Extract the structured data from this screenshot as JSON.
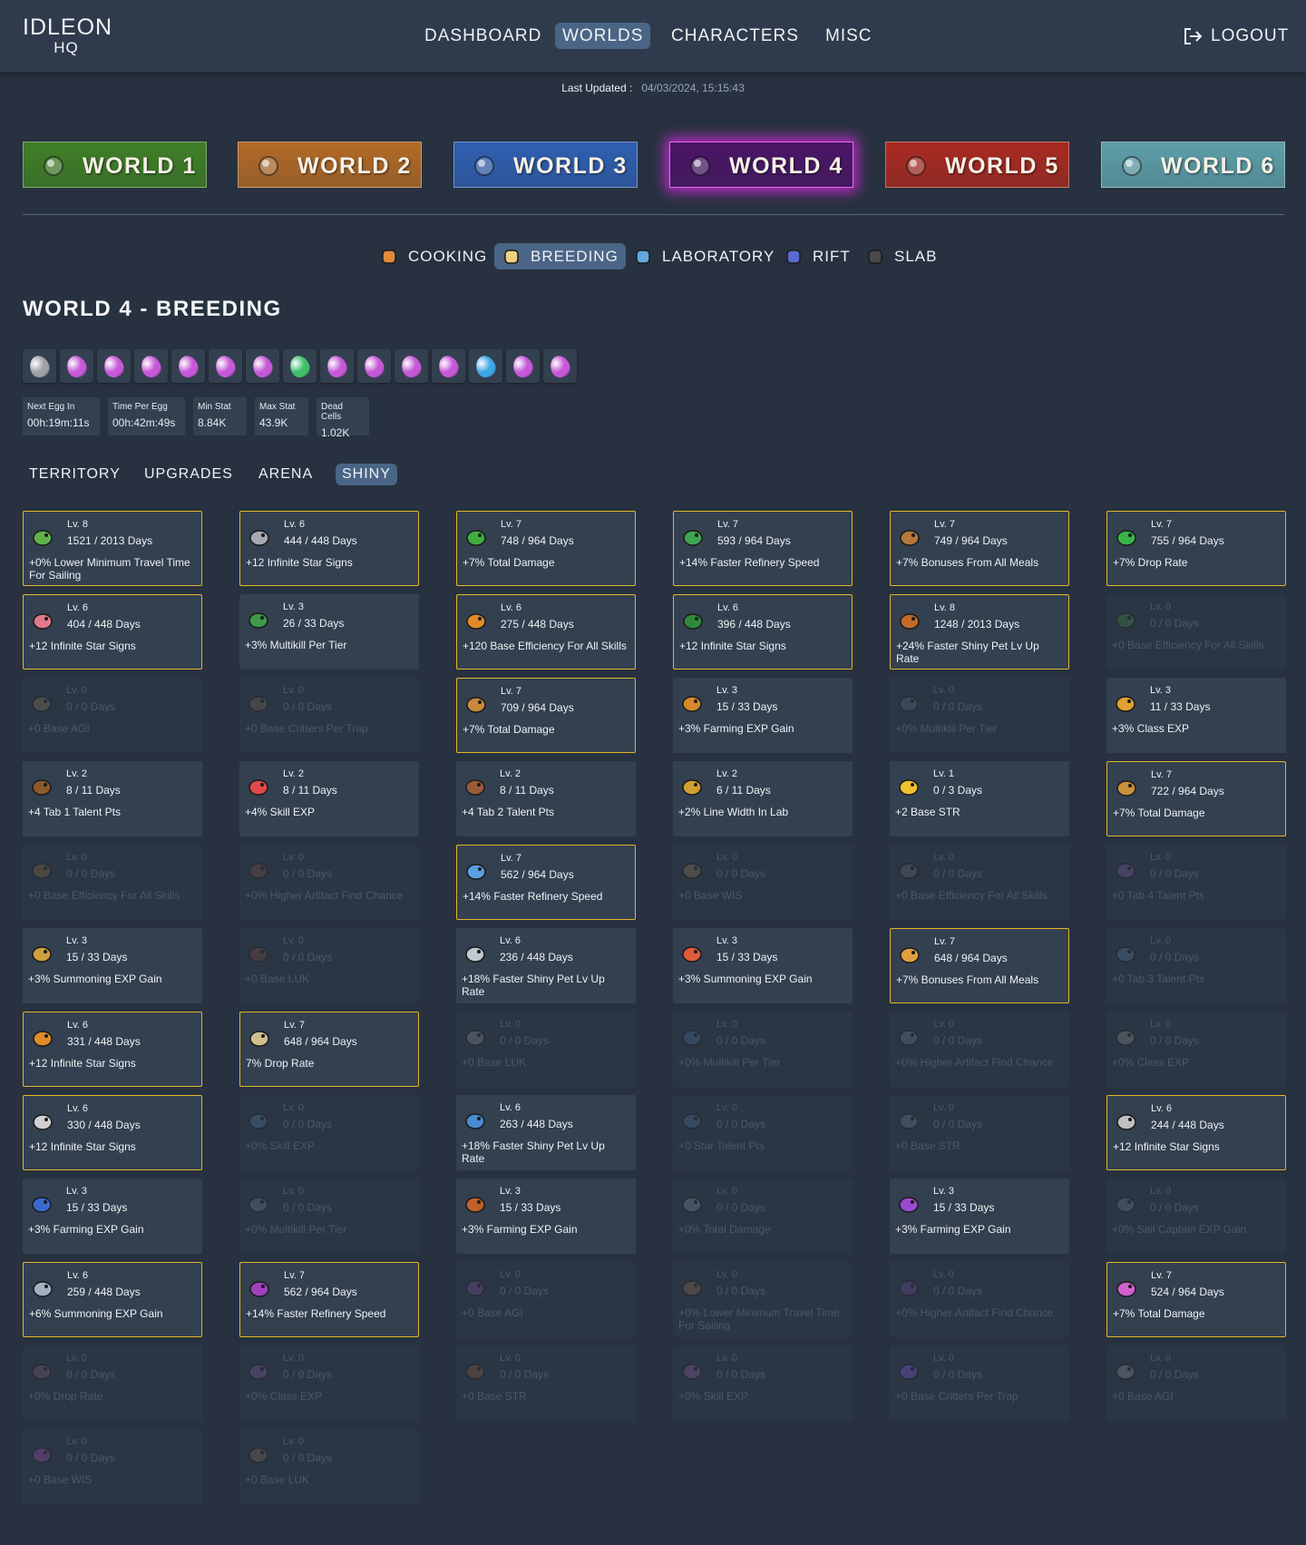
{
  "logo": {
    "line1": "IDLEON",
    "line2": "HQ"
  },
  "nav": {
    "dashboard": "DASHBOARD",
    "worlds": "WORLDS",
    "characters": "CHARACTERS",
    "misc": "MISC",
    "logout": "LOGOUT"
  },
  "last_updated": {
    "label": "Last Updated :",
    "value": "04/03/2024, 15:15:43"
  },
  "worlds": [
    {
      "label": "WORLD 1",
      "bg": "#3f7f26",
      "icon": "world-1-icon"
    },
    {
      "label": "WORLD 2",
      "bg": "#b26a26",
      "icon": "world-2-icon"
    },
    {
      "label": "WORLD 3",
      "bg": "#2f5fb0",
      "icon": "world-3-icon"
    },
    {
      "label": "WORLD 4",
      "bg": "#4a1566",
      "icon": "world-4-icon"
    },
    {
      "label": "WORLD 5",
      "bg": "#a92a20",
      "icon": "world-5-icon"
    },
    {
      "label": "WORLD 6",
      "bg": "#5d9fa9",
      "icon": "world-6-icon"
    }
  ],
  "subtabs": [
    {
      "label": "COOKING",
      "icon": "cooking-icon"
    },
    {
      "label": "BREEDING",
      "icon": "breeding-icon"
    },
    {
      "label": "LABORATORY",
      "icon": "laboratory-icon"
    },
    {
      "label": "RIFT",
      "icon": "rift-icon"
    },
    {
      "label": "SLAB",
      "icon": "slab-icon"
    }
  ],
  "page_title": "WORLD 4 - BREEDING",
  "eggs": [
    "#9ea1a6",
    "#c658d8",
    "#c658d8",
    "#c658d8",
    "#c658d8",
    "#c658d8",
    "#c658d8",
    "#3ec06a",
    "#c658d8",
    "#c658d8",
    "#c658d8",
    "#c658d8",
    "#3ea6e6",
    "#c658d8",
    "#c658d8"
  ],
  "stats": [
    {
      "label": "Next Egg In",
      "value": "00h:19m:11s"
    },
    {
      "label": "Time Per Egg",
      "value": "00h:42m:49s"
    },
    {
      "label": "Min Stat",
      "value": "8.84K"
    },
    {
      "label": "Max Stat",
      "value": "43.9K"
    },
    {
      "label": "Dead Cells",
      "value": "1.02K"
    }
  ],
  "tabs": {
    "territory": "TERRITORY",
    "upgrades": "UPGRADES",
    "arena": "ARENA",
    "shiny": "SHINY"
  },
  "colors": {
    "accent": "#4a6585",
    "gold_border": "#e0b72a",
    "card_bg": "#33404f",
    "page_bg": "#27313f"
  },
  "pets": [
    {
      "lv": "Lv. 8",
      "days": "1521 / 2013 Days",
      "bonus": "+0% Lower Minimum Travel Time For Sailing",
      "gold": true,
      "dim": false,
      "color": "#5fb24a"
    },
    {
      "lv": "Lv. 6",
      "days": "444 / 448 Days",
      "bonus": "+12 Infinite Star Signs",
      "gold": true,
      "dim": false,
      "color": "#a4a8b0"
    },
    {
      "lv": "Lv. 7",
      "days": "748 / 964 Days",
      "bonus": "+7% Total Damage",
      "gold": true,
      "dim": false,
      "color": "#3fae3f"
    },
    {
      "lv": "Lv. 7",
      "days": "593 / 964 Days",
      "bonus": "+14% Faster Refinery Speed",
      "gold": true,
      "dim": false,
      "color": "#3da550"
    },
    {
      "lv": "Lv. 7",
      "days": "749 / 964 Days",
      "bonus": "+7% Bonuses From All Meals",
      "gold": true,
      "dim": false,
      "color": "#b5773a"
    },
    {
      "lv": "Lv. 7",
      "days": "755 / 964 Days",
      "bonus": "+7% Drop Rate",
      "gold": true,
      "dim": false,
      "color": "#36b44a"
    },
    {
      "lv": "Lv. 6",
      "days": "404 / 448 Days",
      "bonus": "+12 Infinite Star Signs",
      "gold": true,
      "dim": false,
      "color": "#e07a8a"
    },
    {
      "lv": "Lv. 3",
      "days": "26 / 33 Days",
      "bonus": "+3% Multikill Per Tier",
      "gold": false,
      "dim": false,
      "color": "#3c9a4a"
    },
    {
      "lv": "Lv. 6",
      "days": "275 / 448 Days",
      "bonus": "+120 Base Efficiency For All Skills",
      "gold": true,
      "dim": false,
      "color": "#e08a2a"
    },
    {
      "lv": "Lv. 6",
      "days": "396 / 448 Days",
      "bonus": "+12 Infinite Star Signs",
      "gold": true,
      "dim": false,
      "color": "#2f8a3a"
    },
    {
      "lv": "Lv. 8",
      "days": "1248 / 2013 Days",
      "bonus": "+24% Faster Shiny Pet Lv Up Rate",
      "gold": true,
      "dim": false,
      "color": "#c26a2a"
    },
    {
      "lv": "Lv. 0",
      "days": "0 / 0 Days",
      "bonus": "+0 Base Efficiency For All Skills",
      "gold": false,
      "dim": true,
      "color": "#3c8a3a"
    },
    {
      "lv": "Lv. 0",
      "days": "0 / 0 Days",
      "bonus": "+0 Base AGI",
      "gold": false,
      "dim": true,
      "color": "#8a7a5a"
    },
    {
      "lv": "Lv. 0",
      "days": "0 / 0 Days",
      "bonus": "+0 Base Critters Per Trap",
      "gold": false,
      "dim": true,
      "color": "#7a6a4a"
    },
    {
      "lv": "Lv. 7",
      "days": "709 / 964 Days",
      "bonus": "+7% Total Damage",
      "gold": true,
      "dim": false,
      "color": "#c88a3a"
    },
    {
      "lv": "Lv. 3",
      "days": "15 / 33 Days",
      "bonus": "+3% Farming EXP Gain",
      "gold": false,
      "dim": false,
      "color": "#d6892a"
    },
    {
      "lv": "Lv. 0",
      "days": "0 / 0 Days",
      "bonus": "+0% Multikill Per Tier",
      "gold": false,
      "dim": true,
      "color": "#5a6a7a"
    },
    {
      "lv": "Lv. 3",
      "days": "11 / 33 Days",
      "bonus": "+3% Class EXP",
      "gold": false,
      "dim": false,
      "color": "#e0a030"
    },
    {
      "lv": "Lv. 2",
      "days": "8 / 11 Days",
      "bonus": "+4 Tab 1 Talent Pts",
      "gold": false,
      "dim": false,
      "color": "#8a5a2a"
    },
    {
      "lv": "Lv. 2",
      "days": "8 / 11 Days",
      "bonus": "+4% Skill EXP",
      "gold": false,
      "dim": false,
      "color": "#e04a4a"
    },
    {
      "lv": "Lv. 2",
      "days": "8 / 11 Days",
      "bonus": "+4 Tab 2 Talent Pts",
      "gold": false,
      "dim": false,
      "color": "#9a5a3a"
    },
    {
      "lv": "Lv. 2",
      "days": "6 / 11 Days",
      "bonus": "+2% Line Width In Lab",
      "gold": false,
      "dim": false,
      "color": "#d0a030"
    },
    {
      "lv": "Lv. 1",
      "days": "0 / 3 Days",
      "bonus": "+2 Base STR",
      "gold": false,
      "dim": false,
      "color": "#f0c030"
    },
    {
      "lv": "Lv. 7",
      "days": "722 / 964 Days",
      "bonus": "+7% Total Damage",
      "gold": true,
      "dim": false,
      "color": "#c8903a"
    },
    {
      "lv": "Lv. 0",
      "days": "0 / 0 Days",
      "bonus": "+0 Base Efficiency For All Skills",
      "gold": false,
      "dim": true,
      "color": "#8a6a3a"
    },
    {
      "lv": "Lv. 0",
      "days": "0 / 0 Days",
      "bonus": "+0% Higher Artifact Find Chance",
      "gold": false,
      "dim": true,
      "color": "#7a4a3a"
    },
    {
      "lv": "Lv. 7",
      "days": "562 / 964 Days",
      "bonus": "+14% Faster Refinery Speed",
      "gold": true,
      "dim": false,
      "color": "#5aa0e0"
    },
    {
      "lv": "Lv. 0",
      "days": "0 / 0 Days",
      "bonus": "+0 Base WIS",
      "gold": false,
      "dim": true,
      "color": "#8a7a4a"
    },
    {
      "lv": "Lv. 0",
      "days": "0 / 0 Days",
      "bonus": "+0 Base Efficiency For All Skills",
      "gold": false,
      "dim": true,
      "color": "#6a6a6a"
    },
    {
      "lv": "Lv. 0",
      "days": "0 / 0 Days",
      "bonus": "+0 Tab 4 Talent Pts",
      "gold": false,
      "dim": true,
      "color": "#7a5a9a"
    },
    {
      "lv": "Lv. 3",
      "days": "15 / 33 Days",
      "bonus": "+3% Summoning EXP Gain",
      "gold": false,
      "dim": false,
      "color": "#d0a040"
    },
    {
      "lv": "Lv. 0",
      "days": "0 / 0 Days",
      "bonus": "+0 Base LUK",
      "gold": false,
      "dim": true,
      "color": "#7a4a3a"
    },
    {
      "lv": "Lv. 6",
      "days": "236 / 448 Days",
      "bonus": "+18% Faster Shiny Pet Lv Up Rate",
      "gold": false,
      "dim": false,
      "color": "#c0c8d0"
    },
    {
      "lv": "Lv. 3",
      "days": "15 / 33 Days",
      "bonus": "+3% Summoning EXP Gain",
      "gold": false,
      "dim": false,
      "color": "#e05a3a"
    },
    {
      "lv": "Lv. 7",
      "days": "648 / 964 Days",
      "bonus": "+7% Bonuses From All Meals",
      "gold": true,
      "dim": false,
      "color": "#e0a040"
    },
    {
      "lv": "Lv. 0",
      "days": "0 / 0 Days",
      "bonus": "+0 Tab 3 Talent Pts",
      "gold": false,
      "dim": true,
      "color": "#5a7a9a"
    },
    {
      "lv": "Lv. 6",
      "days": "331 / 448 Days",
      "bonus": "+12 Infinite Star Signs",
      "gold": true,
      "dim": false,
      "color": "#e08a2a"
    },
    {
      "lv": "Lv. 7",
      "days": "648 / 964 Days",
      "bonus": "7% Drop Rate",
      "gold": true,
      "dim": false,
      "color": "#d0c090"
    },
    {
      "lv": "Lv. 0",
      "days": "0 / 0 Days",
      "bonus": "+0 Base LUK",
      "gold": false,
      "dim": true,
      "color": "#8a8a8a"
    },
    {
      "lv": "Lv. 0",
      "days": "0 / 0 Days",
      "bonus": "+0% Multikill Per Tier",
      "gold": false,
      "dim": true,
      "color": "#4a6a9a"
    },
    {
      "lv": "Lv. 0",
      "days": "0 / 0 Days",
      "bonus": "+0% Higher Artifact Find Chance",
      "gold": false,
      "dim": true,
      "color": "#6a7a8a"
    },
    {
      "lv": "Lv. 0",
      "days": "0 / 0 Days",
      "bonus": "+0% Class EXP",
      "gold": false,
      "dim": true,
      "color": "#8a8a8a"
    },
    {
      "lv": "Lv. 6",
      "days": "330 / 448 Days",
      "bonus": "+12 Infinite Star Signs",
      "gold": true,
      "dim": false,
      "color": "#d0d0d0"
    },
    {
      "lv": "Lv. 0",
      "days": "0 / 0 Days",
      "bonus": "+0% Skill EXP",
      "gold": false,
      "dim": true,
      "color": "#4a7a9a"
    },
    {
      "lv": "Lv. 6",
      "days": "263 / 448 Days",
      "bonus": "+18% Faster Shiny Pet Lv Up Rate",
      "gold": false,
      "dim": false,
      "color": "#4a8ad0"
    },
    {
      "lv": "Lv. 0",
      "days": "0 / 0 Days",
      "bonus": "+0 Star Talent Pts",
      "gold": false,
      "dim": true,
      "color": "#4a6a9a"
    },
    {
      "lv": "Lv. 0",
      "days": "0 / 0 Days",
      "bonus": "+0 Base STR",
      "gold": false,
      "dim": true,
      "color": "#6a7a8a"
    },
    {
      "lv": "Lv. 6",
      "days": "244 / 448 Days",
      "bonus": "+12 Infinite Star Signs",
      "gold": true,
      "dim": false,
      "color": "#c0c0c0"
    },
    {
      "lv": "Lv. 3",
      "days": "15 / 33 Days",
      "bonus": "+3% Farming EXP Gain",
      "gold": false,
      "dim": false,
      "color": "#3a6ad0"
    },
    {
      "lv": "Lv. 0",
      "days": "0 / 0 Days",
      "bonus": "+0% Multikill Per Tier",
      "gold": false,
      "dim": true,
      "color": "#6a7a8a"
    },
    {
      "lv": "Lv. 3",
      "days": "15 / 33 Days",
      "bonus": "+3% Farming EXP Gain",
      "gold": false,
      "dim": false,
      "color": "#c0602a"
    },
    {
      "lv": "Lv. 0",
      "days": "0 / 0 Days",
      "bonus": "+0% Total Damage",
      "gold": false,
      "dim": true,
      "color": "#7a8a9a"
    },
    {
      "lv": "Lv. 3",
      "days": "15 / 33 Days",
      "bonus": "+3% Farming EXP Gain",
      "gold": false,
      "dim": false,
      "color": "#9a4ad0"
    },
    {
      "lv": "Lv. 0",
      "days": "0 / 0 Days",
      "bonus": "+0% Sail Captain EXP Gain",
      "gold": false,
      "dim": true,
      "color": "#6a7a8a"
    },
    {
      "lv": "Lv. 6",
      "days": "259 / 448 Days",
      "bonus": "+6% Summoning EXP Gain",
      "gold": true,
      "dim": false,
      "color": "#a0b0c0"
    },
    {
      "lv": "Lv. 7",
      "days": "562 / 964 Days",
      "bonus": "+14% Faster Refinery Speed",
      "gold": true,
      "dim": false,
      "color": "#a040c0"
    },
    {
      "lv": "Lv. 0",
      "days": "0 / 0 Days",
      "bonus": "+0 Base AGI",
      "gold": false,
      "dim": true,
      "color": "#7a4a9a"
    },
    {
      "lv": "Lv. 0",
      "days": "0 / 0 Days",
      "bonus": "+0% Lower Minimum Travel Time For Sailing",
      "gold": false,
      "dim": true,
      "color": "#8a6a4a"
    },
    {
      "lv": "Lv. 0",
      "days": "0 / 0 Days",
      "bonus": "+0% Higher Artifact Find Chance",
      "gold": false,
      "dim": true,
      "color": "#6a4a9a"
    },
    {
      "lv": "Lv. 7",
      "days": "524 / 964 Days",
      "bonus": "+7% Total Damage",
      "gold": true,
      "dim": false,
      "color": "#d060d0"
    },
    {
      "lv": "Lv. 0",
      "days": "0 / 0 Days",
      "bonus": "+0% Drop Rate",
      "gold": false,
      "dim": true,
      "color": "#7a5a6a"
    },
    {
      "lv": "Lv. 0",
      "days": "0 / 0 Days",
      "bonus": "+0% Class EXP",
      "gold": false,
      "dim": true,
      "color": "#7a5a9a"
    },
    {
      "lv": "Lv. 0",
      "days": "0 / 0 Days",
      "bonus": "+0 Base STR",
      "gold": false,
      "dim": true,
      "color": "#8a5a3a"
    },
    {
      "lv": "Lv. 0",
      "days": "0 / 0 Days",
      "bonus": "+0% Skill EXP",
      "gold": false,
      "dim": true,
      "color": "#8a5a9a"
    },
    {
      "lv": "Lv. 0",
      "days": "0 / 0 Days",
      "bonus": "+0 Base Critters Per Trap",
      "gold": false,
      "dim": true,
      "color": "#7a5ad0"
    },
    {
      "lv": "Lv. 0",
      "days": "0 / 0 Days",
      "bonus": "+0 Base AGI",
      "gold": false,
      "dim": true,
      "color": "#8a8a9a"
    },
    {
      "lv": "Lv. 0",
      "days": "0 / 0 Days",
      "bonus": "+0 Base WIS",
      "gold": false,
      "dim": true,
      "color": "#9a4ab0"
    },
    {
      "lv": "Lv. 0",
      "days": "0 / 0 Days",
      "bonus": "+0 Base LUK",
      "gold": false,
      "dim": true,
      "color": "#7a6a5a"
    }
  ]
}
